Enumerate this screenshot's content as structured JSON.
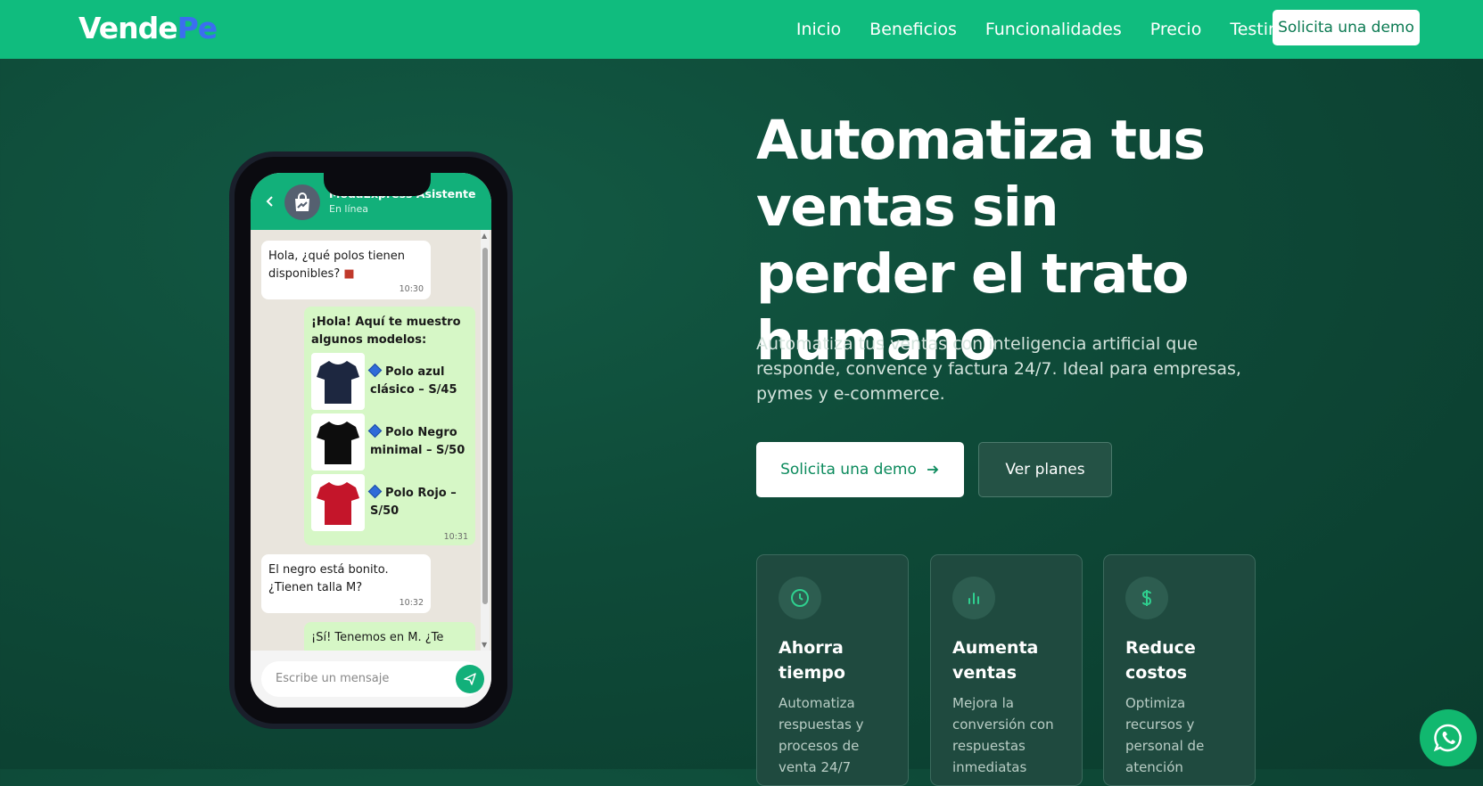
{
  "nav": {
    "logo_part1": "Vende",
    "logo_part2": "Pe",
    "links": [
      "Inicio",
      "Beneficios",
      "Funcionalidades",
      "Precio",
      "Testimonios"
    ],
    "cta": "Solicita una demo"
  },
  "phone": {
    "contact_name": "ModaExpress Asistente",
    "contact_status": "En línea",
    "messages": [
      {
        "text": "Hola, ¿qué polos tienen disponibles?",
        "time": "10:30"
      },
      {
        "text": "¡Hola! Aquí te muestro algunos modelos:",
        "time": "10:31",
        "products": [
          {
            "name": "Polo azul clásico – S/45"
          },
          {
            "name": "Polo Negro minimal – S/50"
          },
          {
            "name": "Polo Rojo – S/50"
          }
        ]
      },
      {
        "text": "El negro está bonito. ¿Tienen talla M?",
        "time": "10:32"
      },
      {
        "text": "¡Sí! Tenemos en M. ¿Te"
      }
    ],
    "input_placeholder": "Escribe un mensaje"
  },
  "hero": {
    "title": "Automatiza tus ventas sin perder el trato humano",
    "subtitle": "Automatiza tus ventas con inteligencia artificial que responde, convence y factura 24/7. Ideal para empresas, pymes y e-commerce.",
    "btn_demo": "Solicita una demo",
    "btn_plans": "Ver planes"
  },
  "cards": [
    {
      "icon": "clock-icon",
      "title": "Ahorra tiempo",
      "desc": "Automatiza respuestas y procesos de venta 24/7"
    },
    {
      "icon": "bar-chart-icon",
      "title": "Aumenta ventas",
      "desc": "Mejora la conversión con respuestas inmediatas"
    },
    {
      "icon": "dollar-icon",
      "title": "Reduce costos",
      "desc": "Optimiza recursos y personal de atención"
    }
  ],
  "colors": {
    "brand_green": "#10bc7e",
    "logo_accent": "#3b6ef0",
    "hero_bg": "#0e4a38"
  }
}
